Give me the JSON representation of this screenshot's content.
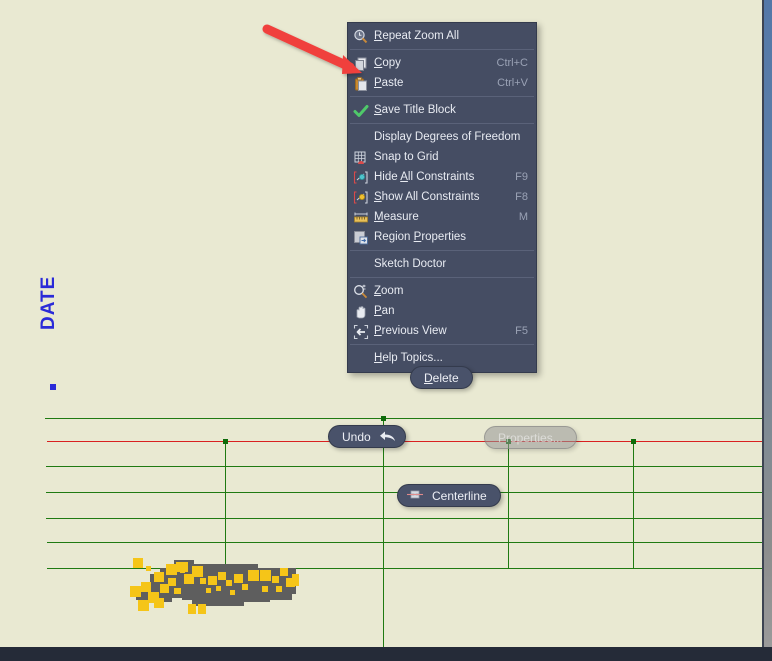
{
  "app": {
    "canvas_bg": "#e9e9d2",
    "accent_green": "#1f7a12",
    "accent_red": "#d92020",
    "menu_bg": "#454d63",
    "selection_yellow": "#f5c518",
    "geometry_gray": "#5e5e5e",
    "bottom_bar_color": "#252b38"
  },
  "canvas": {
    "date_label": "DATE"
  },
  "context_menu": {
    "groups": [
      {
        "items": [
          {
            "label": "Repeat Zoom All",
            "mnemonic": "R",
            "accel": "",
            "icon": "repeat-zoom-all-icon",
            "enabled": true
          }
        ]
      },
      {
        "items": [
          {
            "label": "Copy",
            "mnemonic": "C",
            "accel": "Ctrl+C",
            "icon": "copy-icon",
            "enabled": true
          },
          {
            "label": "Paste",
            "mnemonic": "P",
            "accel": "Ctrl+V",
            "icon": "paste-icon",
            "enabled": true
          }
        ]
      },
      {
        "items": [
          {
            "label": "Save Title Block",
            "mnemonic": "S",
            "accel": "",
            "icon": "green-check-icon",
            "enabled": true
          }
        ]
      },
      {
        "items": [
          {
            "label": "Display Degrees of Freedom",
            "mnemonic": "",
            "accel": "",
            "icon": "none",
            "enabled": true
          },
          {
            "label": "Snap to Grid",
            "mnemonic": "",
            "accel": "",
            "icon": "snap-to-grid-icon",
            "enabled": true
          },
          {
            "label": "Hide All Constraints",
            "mnemonic": "A",
            "accel": "F9",
            "icon": "hide-constraints-icon",
            "enabled": true
          },
          {
            "label": "Show All Constraints",
            "mnemonic": "S",
            "accel": "F8",
            "icon": "show-constraints-icon",
            "enabled": true
          },
          {
            "label": "Measure",
            "mnemonic": "M",
            "accel": "M",
            "icon": "ruler-icon",
            "enabled": true
          },
          {
            "label": "Region Properties",
            "mnemonic": "P",
            "accel": "",
            "icon": "region-properties-icon",
            "enabled": true
          }
        ]
      },
      {
        "items": [
          {
            "label": "Sketch Doctor",
            "mnemonic": "",
            "accel": "",
            "icon": "none",
            "enabled": true
          }
        ]
      },
      {
        "items": [
          {
            "label": "Zoom",
            "mnemonic": "Z",
            "accel": "",
            "icon": "zoom-icon",
            "enabled": true
          },
          {
            "label": "Pan",
            "mnemonic": "P",
            "accel": "",
            "icon": "pan-hand-icon",
            "enabled": true
          },
          {
            "label": "Previous View",
            "mnemonic": "P",
            "accel": "F5",
            "icon": "previous-view-icon",
            "enabled": true
          }
        ]
      },
      {
        "items": [
          {
            "label": "Help Topics...",
            "mnemonic": "H",
            "accel": "",
            "icon": "none",
            "enabled": true
          }
        ]
      }
    ]
  },
  "floating_buttons": {
    "delete": {
      "label": "Delete",
      "mnemonic": "D",
      "enabled": true,
      "icon": "none"
    },
    "undo": {
      "label": "Undo",
      "mnemonic": "",
      "enabled": true,
      "icon": "undo-arrow-icon"
    },
    "properties": {
      "label": "Properties...",
      "mnemonic": "",
      "enabled": false,
      "icon": "none"
    },
    "centerline": {
      "label": "Centerline",
      "mnemonic": "",
      "enabled": true,
      "icon": "centerline-icon"
    }
  },
  "annotation": {
    "arrow_color": "#f0413c",
    "points_at": "Copy"
  }
}
